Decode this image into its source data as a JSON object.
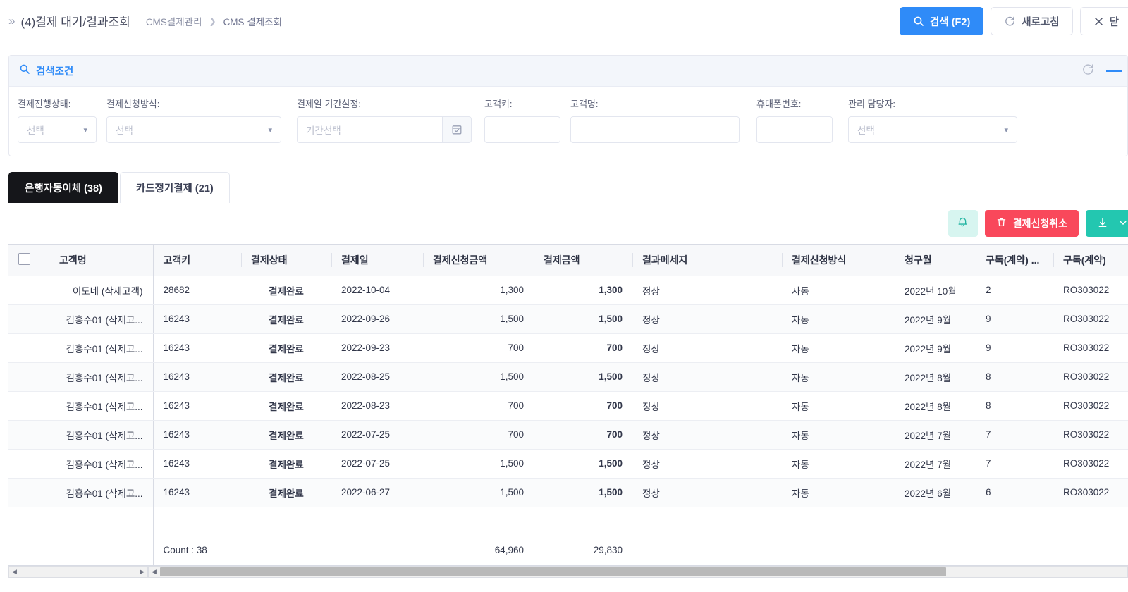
{
  "header": {
    "expand_icon": "double-chevron-right-icon",
    "title": "(4)결제 대기/결과조회",
    "breadcrumb": [
      "CMS결제관리",
      "CMS 결제조회"
    ],
    "buttons": {
      "search": "검색 (F2)",
      "refresh": "새로고침",
      "close": "닫"
    }
  },
  "search_panel": {
    "title": "검색조건",
    "reset_icon": "refresh-circle-icon",
    "collapse_icon": "minus-icon",
    "fields": [
      {
        "label": "결제진행상태:",
        "type": "select",
        "value": "선택",
        "placeholder": "선택"
      },
      {
        "label": "결제신청방식:",
        "type": "select",
        "value": "선택",
        "placeholder": "선택"
      },
      {
        "label": "결제일 기간설정:",
        "type": "daterange",
        "value": "",
        "placeholder": "기간선택",
        "icon": "calendar-icon"
      },
      {
        "label": "고객키:",
        "type": "text",
        "value": "",
        "placeholder": ""
      },
      {
        "label": "고객명:",
        "type": "text",
        "value": "",
        "placeholder": ""
      },
      {
        "label": "휴대폰번호:",
        "type": "text",
        "value": "",
        "placeholder": ""
      },
      {
        "label": "관리 담당자:",
        "type": "select",
        "value": "선택",
        "placeholder": "선택"
      }
    ]
  },
  "tabs": [
    {
      "label": "은행자동이체 (38)",
      "active": true
    },
    {
      "label": "카드정기결제 (21)",
      "active": false
    }
  ],
  "grid_toolbar": {
    "bell_icon": "bell-icon",
    "cancel_button": "결제신청취소",
    "cancel_icon": "trash-icon",
    "download_icon": "download-icon",
    "download_caret": "chevron-down-icon"
  },
  "grid": {
    "columns": [
      "고객명",
      "고객키",
      "결제상태",
      "결제일",
      "결제신청금액",
      "결제금액",
      "결과메세지",
      "결제신청방식",
      "청구월",
      "구독(계약) ...",
      "구독(계약)"
    ],
    "rows": [
      {
        "checked": false,
        "name": "이도네 (삭제고객)",
        "key": "28682",
        "status": "결제완료",
        "date": "2022-10-04",
        "req_amount": "1,300",
        "amount": "1,300",
        "message": "정상",
        "method": "자동",
        "billing_month": "2022년 10월",
        "sub_count": "2",
        "sub_code": "RO303022"
      },
      {
        "checked": false,
        "name": "김흥수01 (삭제고...",
        "key": "16243",
        "status": "결제완료",
        "date": "2022-09-26",
        "req_amount": "1,500",
        "amount": "1,500",
        "message": "정상",
        "method": "자동",
        "billing_month": "2022년 9월",
        "sub_count": "9",
        "sub_code": "RO303022"
      },
      {
        "checked": false,
        "name": "김흥수01 (삭제고...",
        "key": "16243",
        "status": "결제완료",
        "date": "2022-09-23",
        "req_amount": "700",
        "amount": "700",
        "message": "정상",
        "method": "자동",
        "billing_month": "2022년 9월",
        "sub_count": "9",
        "sub_code": "RO303022"
      },
      {
        "checked": false,
        "name": "김흥수01 (삭제고...",
        "key": "16243",
        "status": "결제완료",
        "date": "2022-08-25",
        "req_amount": "1,500",
        "amount": "1,500",
        "message": "정상",
        "method": "자동",
        "billing_month": "2022년 8월",
        "sub_count": "8",
        "sub_code": "RO303022"
      },
      {
        "checked": false,
        "name": "김흥수01 (삭제고...",
        "key": "16243",
        "status": "결제완료",
        "date": "2022-08-23",
        "req_amount": "700",
        "amount": "700",
        "message": "정상",
        "method": "자동",
        "billing_month": "2022년 8월",
        "sub_count": "8",
        "sub_code": "RO303022"
      },
      {
        "checked": false,
        "name": "김흥수01 (삭제고...",
        "key": "16243",
        "status": "결제완료",
        "date": "2022-07-25",
        "req_amount": "700",
        "amount": "700",
        "message": "정상",
        "method": "자동",
        "billing_month": "2022년 7월",
        "sub_count": "7",
        "sub_code": "RO303022"
      },
      {
        "checked": false,
        "name": "김흥수01 (삭제고...",
        "key": "16243",
        "status": "결제완료",
        "date": "2022-07-25",
        "req_amount": "1,500",
        "amount": "1,500",
        "message": "정상",
        "method": "자동",
        "billing_month": "2022년 7월",
        "sub_count": "7",
        "sub_code": "RO303022"
      },
      {
        "checked": false,
        "name": "김흥수01 (삭제고...",
        "key": "16243",
        "status": "결제완료",
        "date": "2022-06-27",
        "req_amount": "1,500",
        "amount": "1,500",
        "message": "정상",
        "method": "자동",
        "billing_month": "2022년 6월",
        "sub_count": "6",
        "sub_code": "RO303022"
      }
    ],
    "summary": {
      "count_label": "Count : 38",
      "req_amount_total": "64,960",
      "amount_total": "29,830"
    }
  },
  "colors": {
    "primary": "#2f8bf8",
    "danger": "#f9485b",
    "teal": "#23c7b0",
    "status_link": "#2f6fe0",
    "amount_blue": "#2a49d6",
    "amount_red": "#e8122b",
    "tab_active_bg": "#15161a"
  }
}
